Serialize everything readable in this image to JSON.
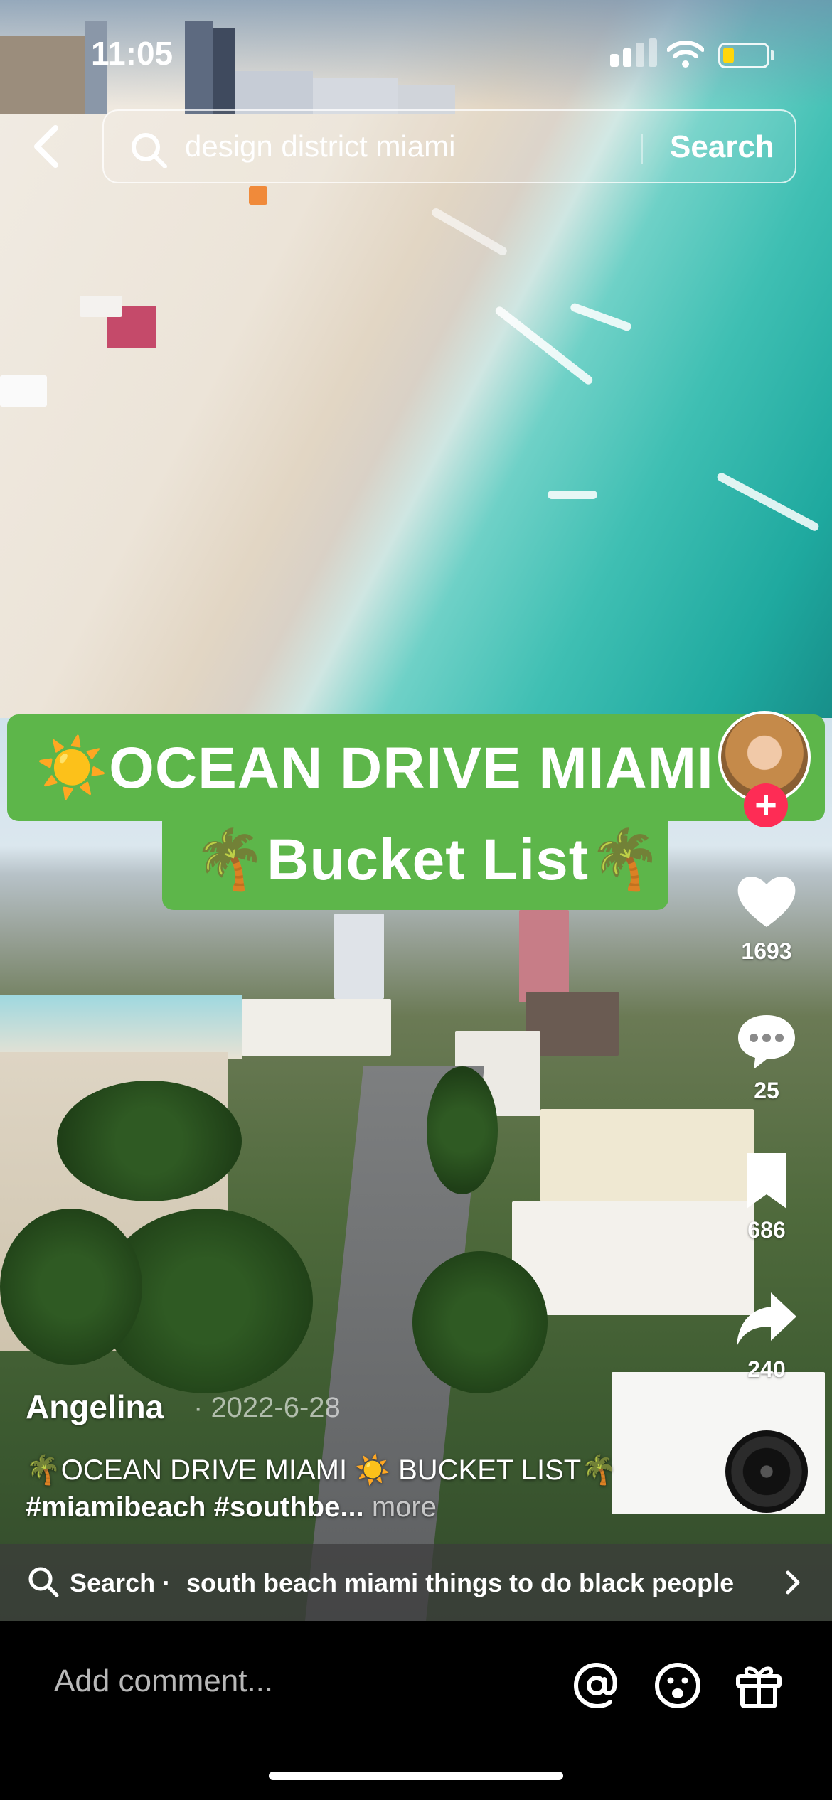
{
  "status_bar": {
    "time": "11:05",
    "battery_level": 0.25
  },
  "search": {
    "query": "design district miami",
    "button_label": "Search"
  },
  "video": {
    "title_line1": "☀️OCEAN DRIVE MIAMI",
    "title_line2": "🌴Bucket List🌴"
  },
  "actions": {
    "likes": "1693",
    "comments": "25",
    "saves": "686",
    "shares": "240"
  },
  "post": {
    "author": "Angelina",
    "date": "2022-6-28",
    "caption_text": "🌴OCEAN DRIVE MIAMI ☀️ BUCKET LIST🌴 ",
    "caption_hashtags": "#miamibeach #southbe...",
    "more_label": "more"
  },
  "related_search": {
    "label": "Search ·",
    "text": "south beach miami things to do black people"
  },
  "comment": {
    "placeholder": "Add comment..."
  },
  "icons": {
    "back": "chevron-left-icon",
    "search": "search-icon",
    "like": "heart-icon",
    "comment": "chat-bubble-icon",
    "save": "bookmark-icon",
    "share": "share-arrow-icon",
    "mention": "at-sign-icon",
    "emoji": "emoji-icon",
    "gift": "gift-icon",
    "music": "music-disc-icon"
  },
  "colors": {
    "follow_accent": "#fe2c55",
    "banner_green": "#5db64a",
    "battery_yellow": "#ffd60a"
  }
}
